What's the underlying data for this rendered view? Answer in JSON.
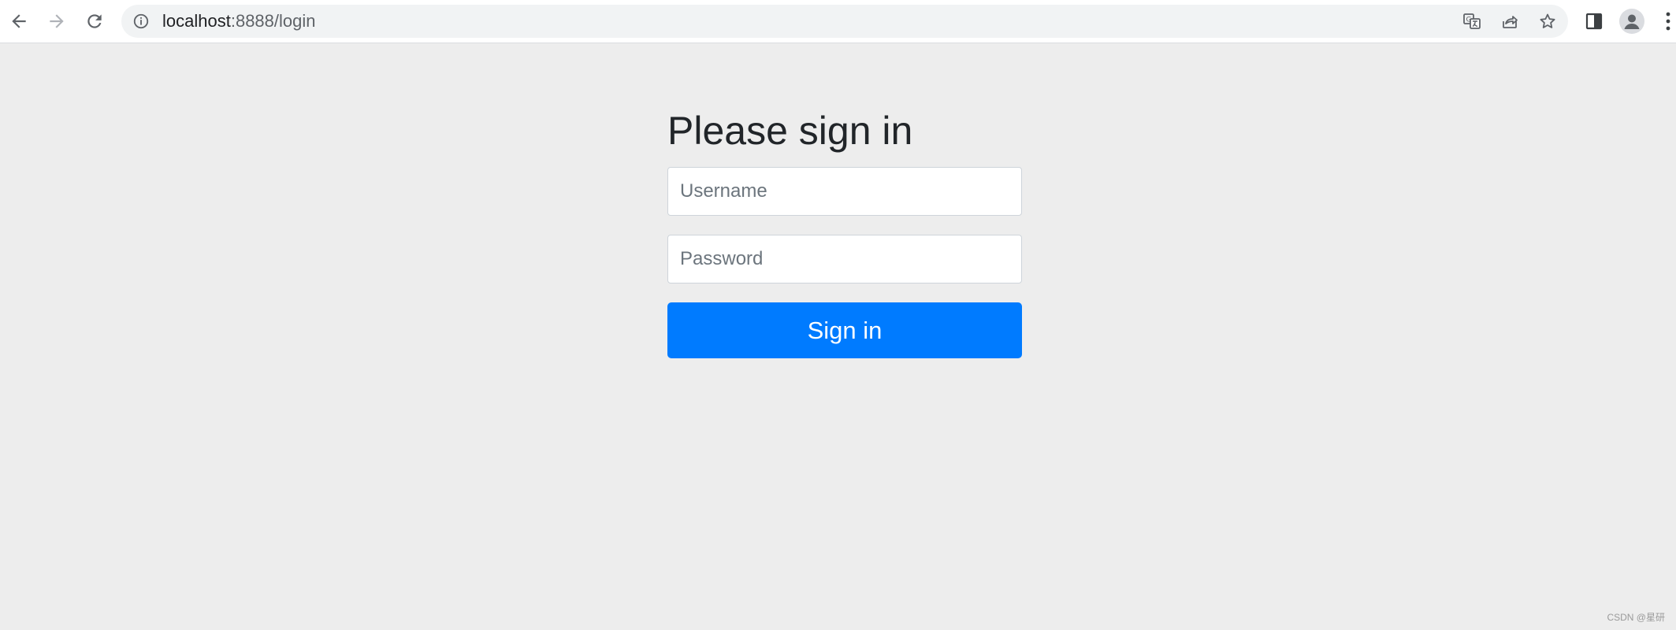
{
  "browser": {
    "url_host": "localhost",
    "url_rest": ":8888/login",
    "icons": {
      "back": "back-arrow-icon",
      "forward": "forward-arrow-icon",
      "reload": "reload-icon",
      "site_info": "info-icon",
      "translate": "translate-icon",
      "share": "share-icon",
      "bookmark": "star-icon",
      "side_panel": "side-panel-icon",
      "profile": "profile-icon",
      "menu": "kebab-menu-icon"
    }
  },
  "form": {
    "heading": "Please sign in",
    "username_placeholder": "Username",
    "password_placeholder": "Password",
    "submit_label": "Sign in"
  },
  "colors": {
    "page_bg": "#ededed",
    "primary": "#007bff",
    "heading": "#212529"
  },
  "watermark": "CSDN @星研"
}
